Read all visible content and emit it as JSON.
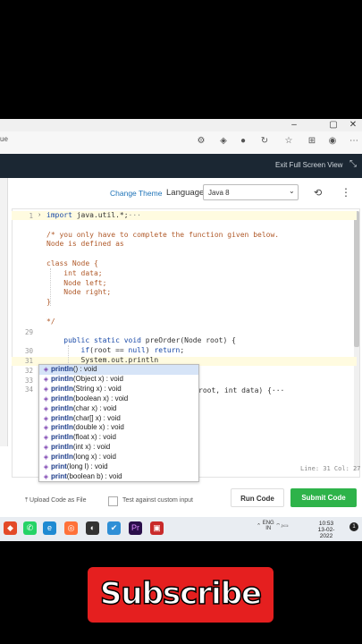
{
  "browser": {
    "address_fragment": "ue",
    "window_buttons": [
      "–",
      "▢",
      "✕"
    ],
    "toolbar_icons": [
      "font-settings-icon",
      "extension-icon",
      "copilot-icon",
      "refresh-alt-icon",
      "favorites-icon",
      "collections-icon",
      "profile-icon",
      "more-icon"
    ]
  },
  "header": {
    "exit_fullscreen_label": "Exit Full Screen View"
  },
  "toolbar": {
    "change_theme": "Change Theme",
    "language_label": "Language",
    "language_value": "Java 8"
  },
  "editor": {
    "lines": [
      {
        "n": "1",
        "html": "<span class='kw'>import</span> java.util.*;<span class='gl'>···</span>"
      },
      {
        "n": "",
        "html": ""
      },
      {
        "n": "",
        "html": "<span class='cm'>/* you only have to complete the function given below.</span>"
      },
      {
        "n": "",
        "html": "<span class='cm'>Node is defined as</span>"
      },
      {
        "n": "",
        "html": ""
      },
      {
        "n": "",
        "html": "<span class='cm'>class Node {</span>"
      },
      {
        "n": "",
        "html": "<span class='cm'>    int data;</span>"
      },
      {
        "n": "",
        "html": "<span class='cm'>    Node left;</span>"
      },
      {
        "n": "",
        "html": "<span class='cm'>    Node right;</span>"
      },
      {
        "n": "",
        "html": "<span class='cm'>}</span>"
      },
      {
        "n": "",
        "html": ""
      },
      {
        "n": "",
        "html": "<span class='cm'>*/</span>"
      },
      {
        "n": "29",
        "html": ""
      },
      {
        "n": "",
        "html": "    <span class='kw'>public static void</span> preOrder(Node root) {"
      },
      {
        "n": "30",
        "html": "        <span class='kw'>if</span>(root == <span class='kw'>null</span>) <span class='kw'>return</span>;"
      },
      {
        "n": "31",
        "html": "        System.out.println"
      },
      {
        "n": "32",
        "html": ""
      },
      {
        "n": "33",
        "html": ""
      },
      {
        "n": "34",
        "html": ""
      }
    ],
    "line34_tail": "root, int data) {···",
    "status": "Line: 31 Col: 27"
  },
  "autocomplete": [
    {
      "name": "println",
      "sig": "() : void"
    },
    {
      "name": "println",
      "sig": "(Object x) : void"
    },
    {
      "name": "println",
      "sig": "(String x) : void"
    },
    {
      "name": "println",
      "sig": "(boolean x) : void"
    },
    {
      "name": "println",
      "sig": "(char x) : void"
    },
    {
      "name": "println",
      "sig": "(char[] x) : void"
    },
    {
      "name": "println",
      "sig": "(double x) : void"
    },
    {
      "name": "println",
      "sig": "(float x) : void"
    },
    {
      "name": "println",
      "sig": "(int x) : void"
    },
    {
      "name": "println",
      "sig": "(long x) : void"
    },
    {
      "name": "print",
      "sig": "(long l) : void"
    },
    {
      "name": "print",
      "sig": "(boolean b) : void"
    }
  ],
  "footer": {
    "upload_label": "Upload Code as File",
    "custom_input_label": "Test against custom input",
    "run_label": "Run Code",
    "submit_label": "Submit Code"
  },
  "taskbar": {
    "lang": "ENG",
    "region": "IN",
    "time": "10:53",
    "date": "13-02-2022",
    "notifications": "1"
  },
  "overlay": {
    "subscribe_text": "Subscribe"
  },
  "colors": {
    "submit": "#2eb34a",
    "dark_header": "#1b2733",
    "subscribe": "#e51f1f",
    "link": "#1e73b8"
  }
}
